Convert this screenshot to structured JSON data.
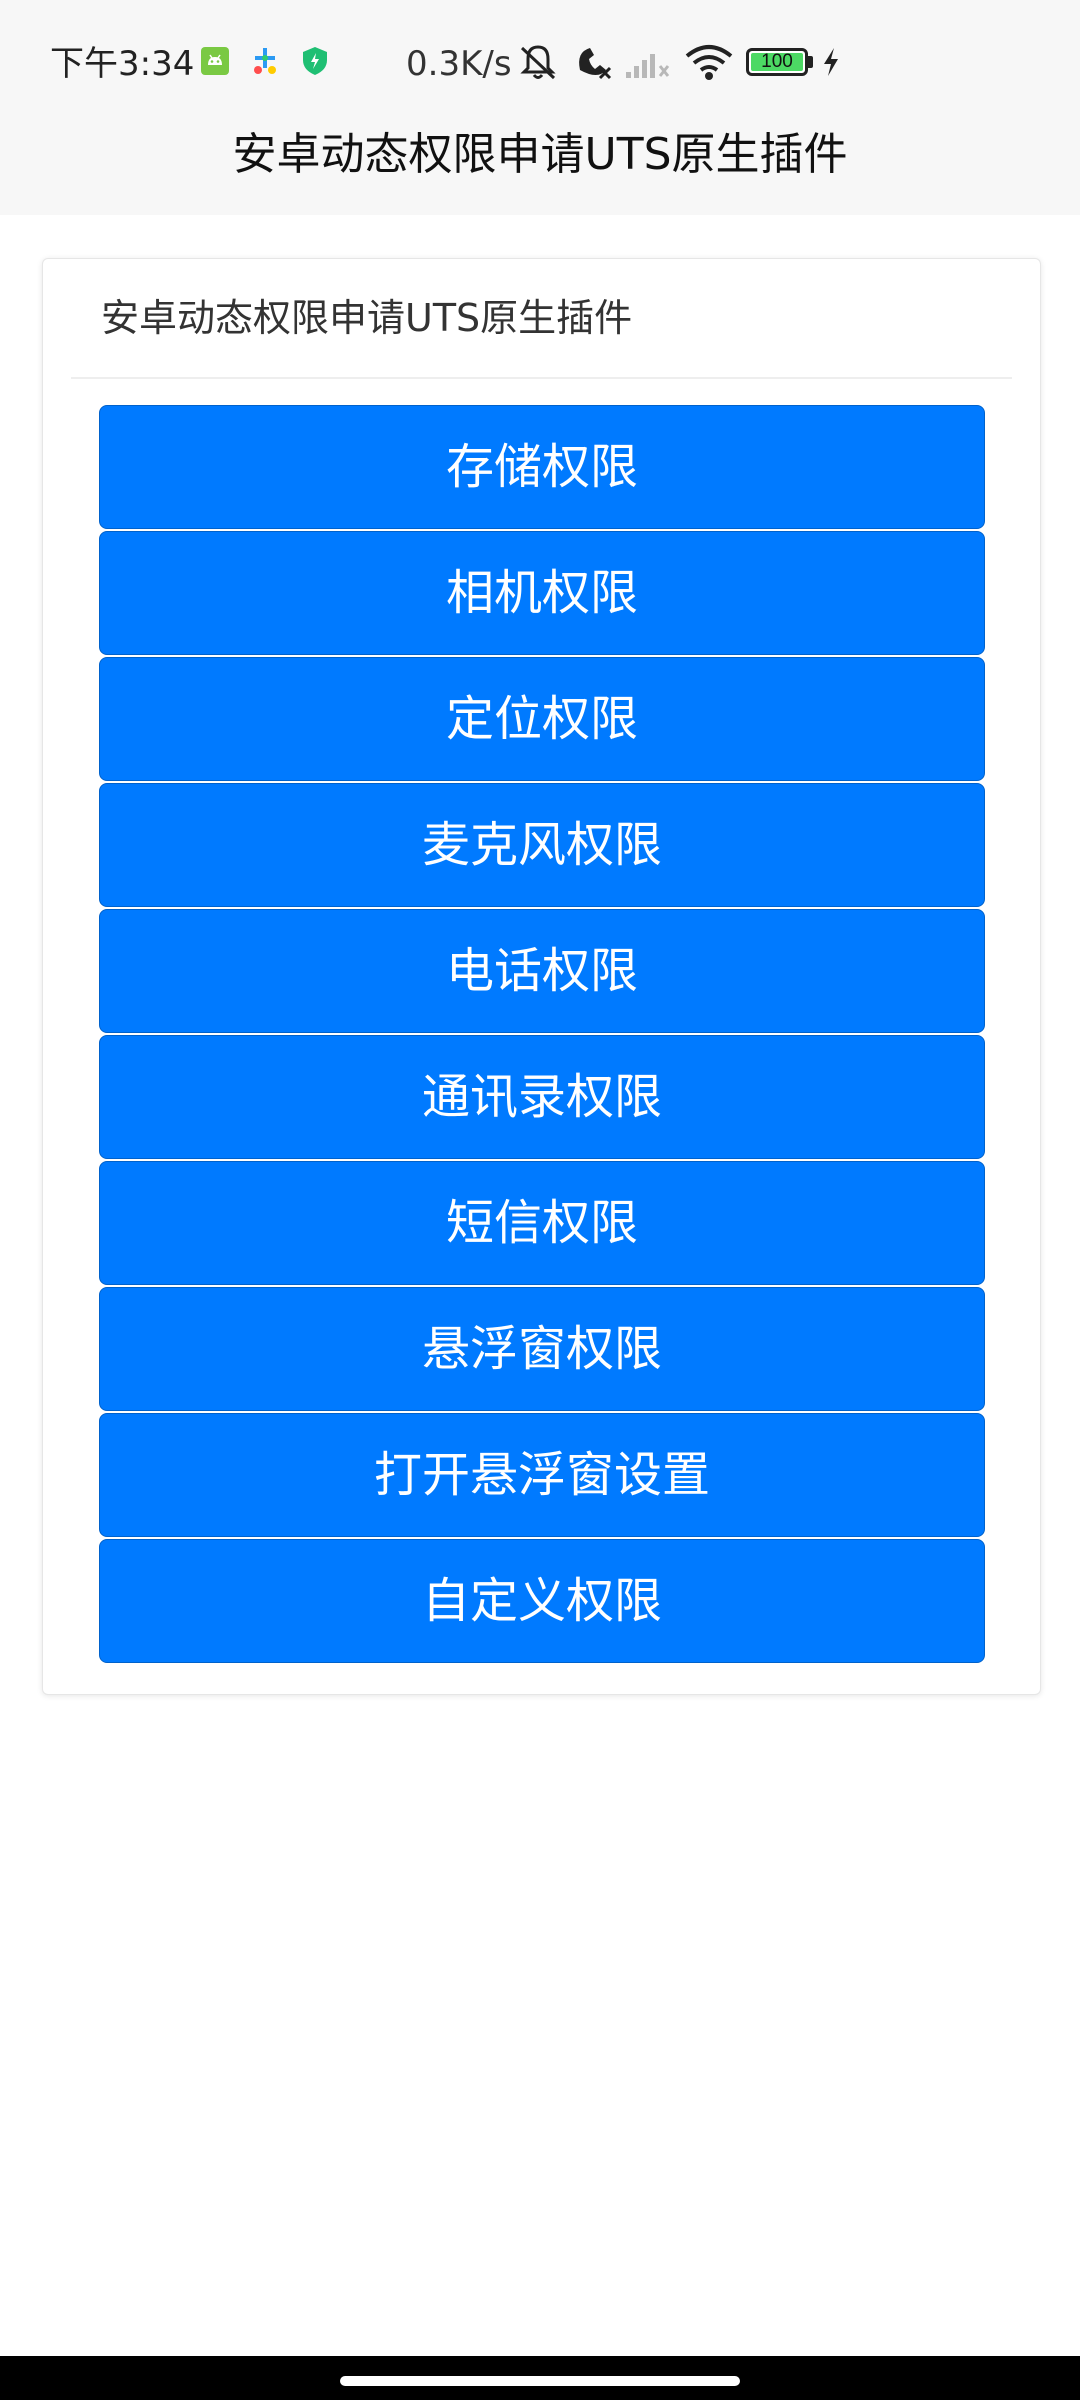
{
  "status_bar": {
    "time": "下午3:34",
    "net_speed": "0.3K/s",
    "battery_level": "100",
    "icons": [
      "android-app-icon",
      "game-app-icon",
      "security-shield-icon",
      "mute-bell-icon",
      "missed-call-icon",
      "signal-icon",
      "wifi-icon",
      "battery-icon",
      "charging-bolt-icon"
    ],
    "colors": {
      "android_green": "#7ac943",
      "shield_green": "#1fbf73",
      "battery_fill": "#4cd964"
    }
  },
  "nav": {
    "title": "安卓动态权限申请UTS原生插件"
  },
  "card": {
    "title": "安卓动态权限申请UTS原生插件"
  },
  "buttons": [
    {
      "label": "存储权限"
    },
    {
      "label": "相机权限"
    },
    {
      "label": "定位权限"
    },
    {
      "label": "麦克风权限"
    },
    {
      "label": "电话权限"
    },
    {
      "label": "通讯录权限"
    },
    {
      "label": "短信权限"
    },
    {
      "label": "悬浮窗权限"
    },
    {
      "label": "打开悬浮窗设置"
    },
    {
      "label": "自定义权限"
    }
  ],
  "theme": {
    "primary": "#007aff",
    "nav_bg": "#f7f7f7",
    "text": "#333333"
  }
}
